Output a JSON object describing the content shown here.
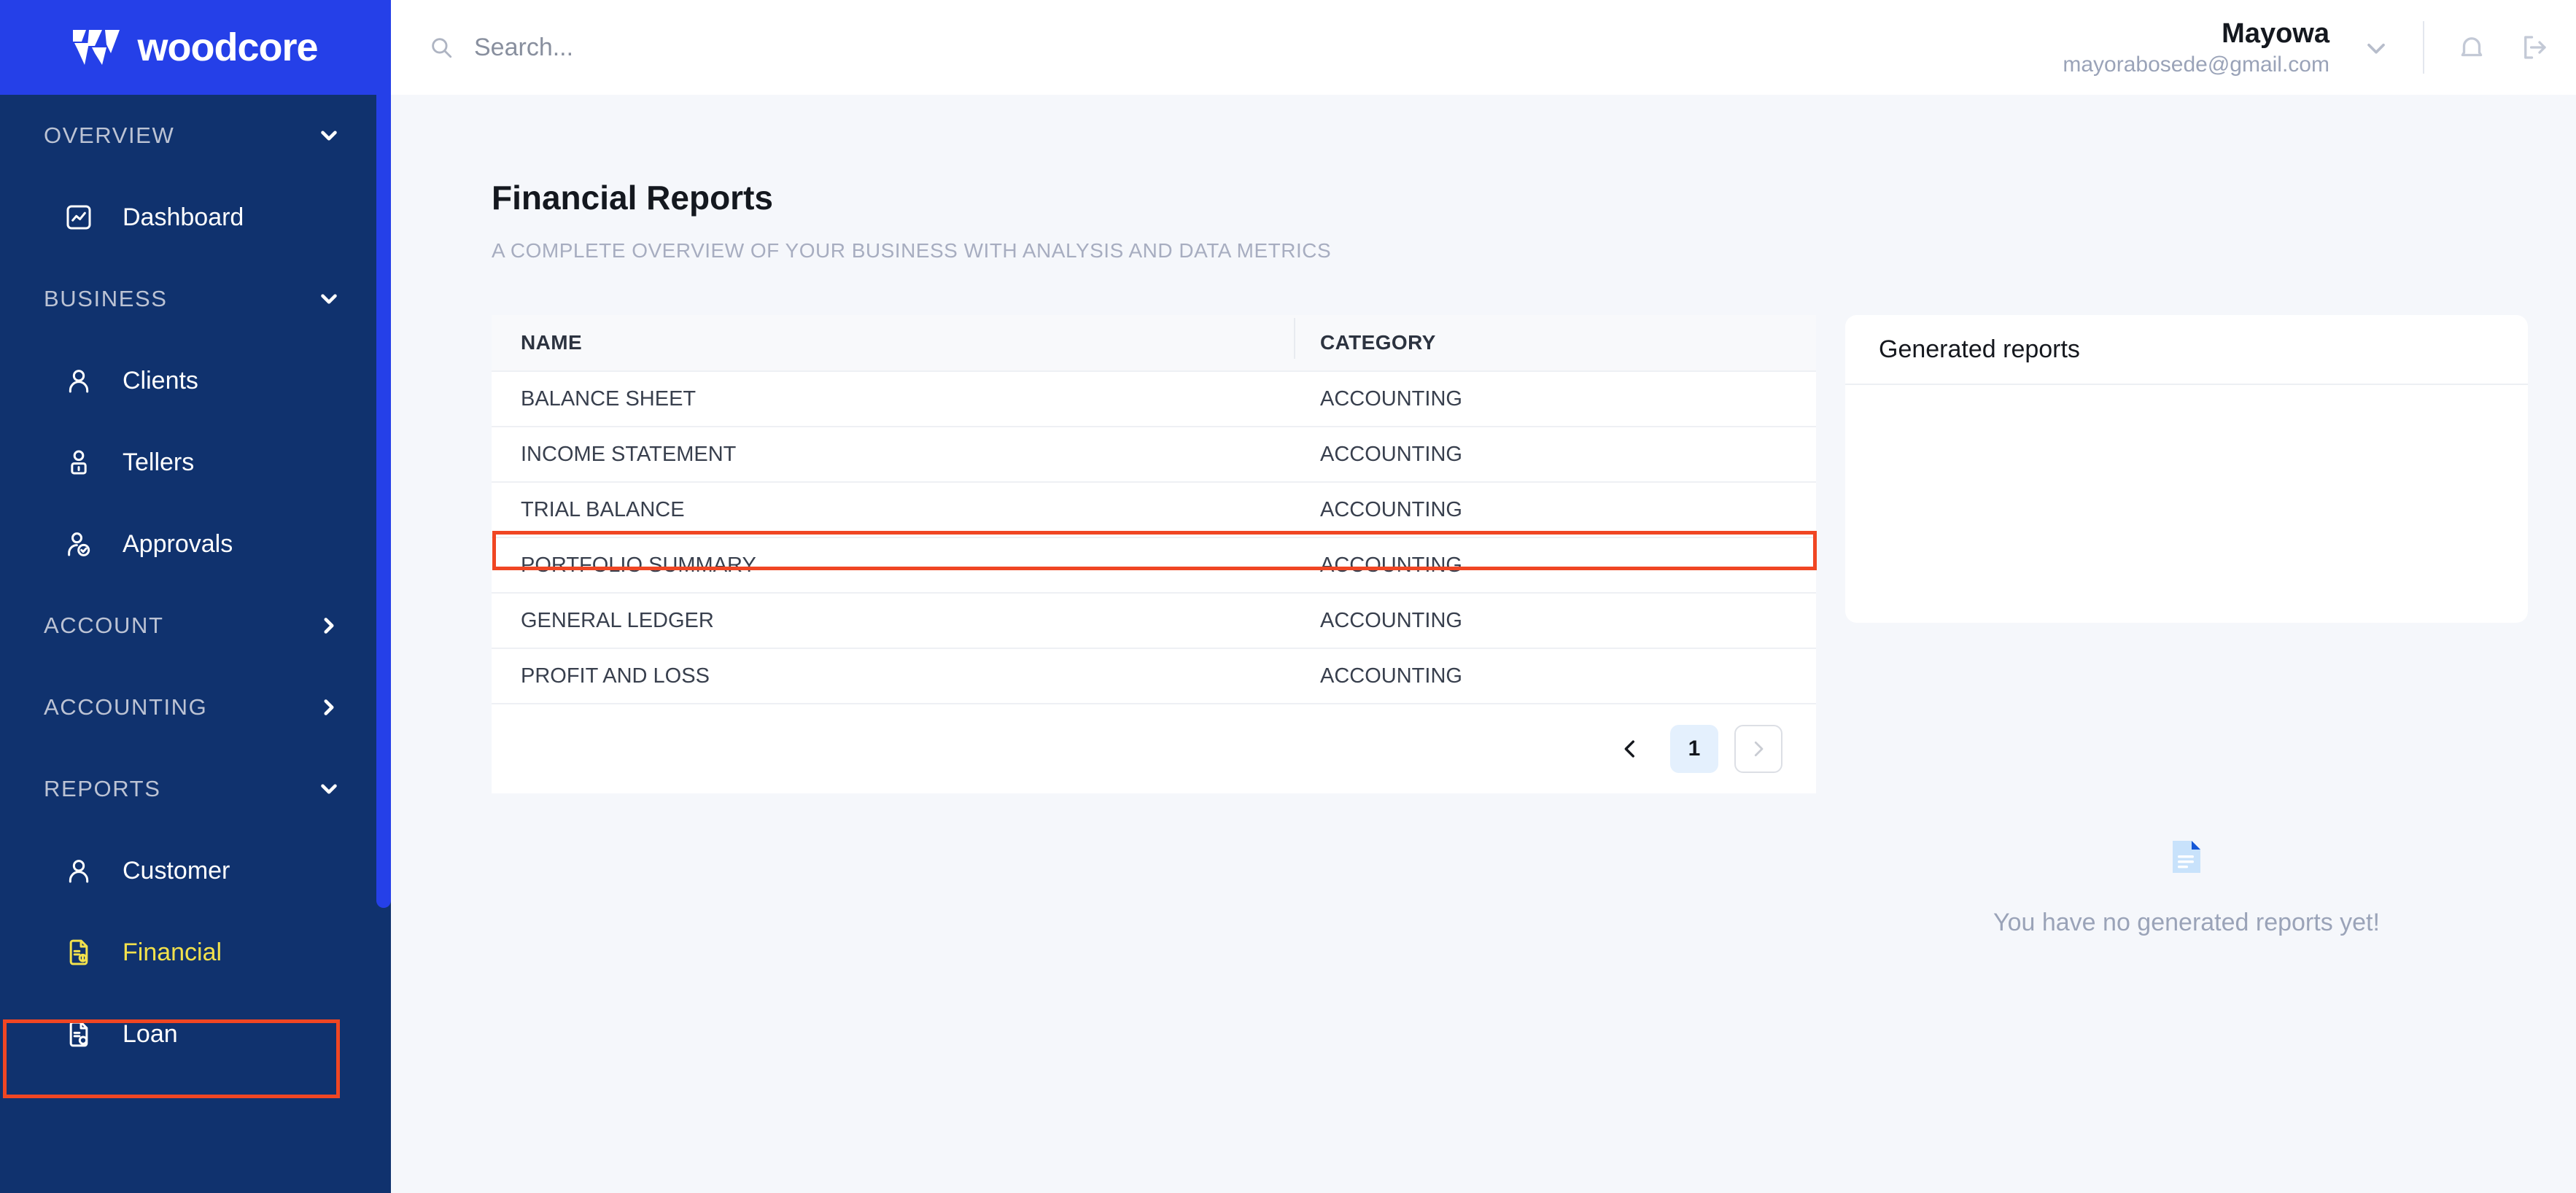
{
  "brand": {
    "name": "woodcore",
    "logo_icon": "woodcore-w-mark",
    "logo_bg": "#2540e8",
    "sidebar_bg": "#10326e"
  },
  "sidebar": {
    "scrollbar_color": "#2540e8",
    "active_item_color": "#f2e14c",
    "groups": [
      {
        "label": "OVERVIEW",
        "expanded": true,
        "chevron": "chevron-down-icon",
        "items": [
          {
            "label": "Dashboard",
            "icon": "chart-square-icon",
            "active": false
          }
        ]
      },
      {
        "label": "BUSINESS",
        "expanded": true,
        "chevron": "chevron-down-icon",
        "items": [
          {
            "label": "Clients",
            "icon": "user-icon",
            "active": false
          },
          {
            "label": "Tellers",
            "icon": "user-lock-icon",
            "active": false
          },
          {
            "label": "Approvals",
            "icon": "user-check-icon",
            "active": false
          }
        ]
      },
      {
        "label": "ACCOUNT",
        "expanded": false,
        "chevron": "chevron-right-icon",
        "items": []
      },
      {
        "label": "ACCOUNTING",
        "expanded": false,
        "chevron": "chevron-right-icon",
        "items": []
      },
      {
        "label": "REPORTS",
        "expanded": true,
        "chevron": "chevron-down-icon",
        "items": [
          {
            "label": "Customer",
            "icon": "user-icon",
            "active": false
          },
          {
            "label": "Financial",
            "icon": "document-dollar-icon",
            "active": true
          },
          {
            "label": "Loan",
            "icon": "document-clock-icon",
            "active": false
          }
        ]
      }
    ]
  },
  "topbar": {
    "search": {
      "placeholder": "Search...",
      "value": "",
      "icon": "search-icon"
    },
    "user": {
      "name": "Mayowa",
      "email": "mayorabosede@gmail.com",
      "chevron": "chevron-down-icon"
    },
    "notifications_icon": "bell-icon",
    "logout_icon": "logout-icon"
  },
  "page": {
    "title": "Financial Reports",
    "subtitle": "A COMPLETE OVERVIEW OF YOUR BUSINESS WITH ANALYSIS AND DATA METRICS"
  },
  "table": {
    "columns": [
      "NAME",
      "CATEGORY"
    ],
    "rows": [
      {
        "name": "BALANCE SHEET",
        "category": "ACCOUNTING",
        "highlighted": false
      },
      {
        "name": "INCOME STATEMENT",
        "category": "ACCOUNTING",
        "highlighted": false
      },
      {
        "name": "TRIAL BALANCE",
        "category": "ACCOUNTING",
        "highlighted": false
      },
      {
        "name": "PORTFOLIO SUMMARY",
        "category": "ACCOUNTING",
        "highlighted": true
      },
      {
        "name": "GENERAL LEDGER",
        "category": "ACCOUNTING",
        "highlighted": false
      },
      {
        "name": "PROFIT AND LOSS",
        "category": "ACCOUNTING",
        "highlighted": false
      }
    ],
    "pagination": {
      "prev_icon": "chevron-left-icon",
      "next_icon": "chevron-right-icon",
      "current_page": "1",
      "next_disabled": true
    }
  },
  "generated_panel": {
    "title": "Generated reports",
    "empty_icon": "document-icon",
    "empty_text": "You have no generated reports yet!"
  },
  "annotations": {
    "color": "#f04623",
    "boxes": [
      "table-row-portfolio-summary",
      "sidebar-item-financial"
    ]
  }
}
